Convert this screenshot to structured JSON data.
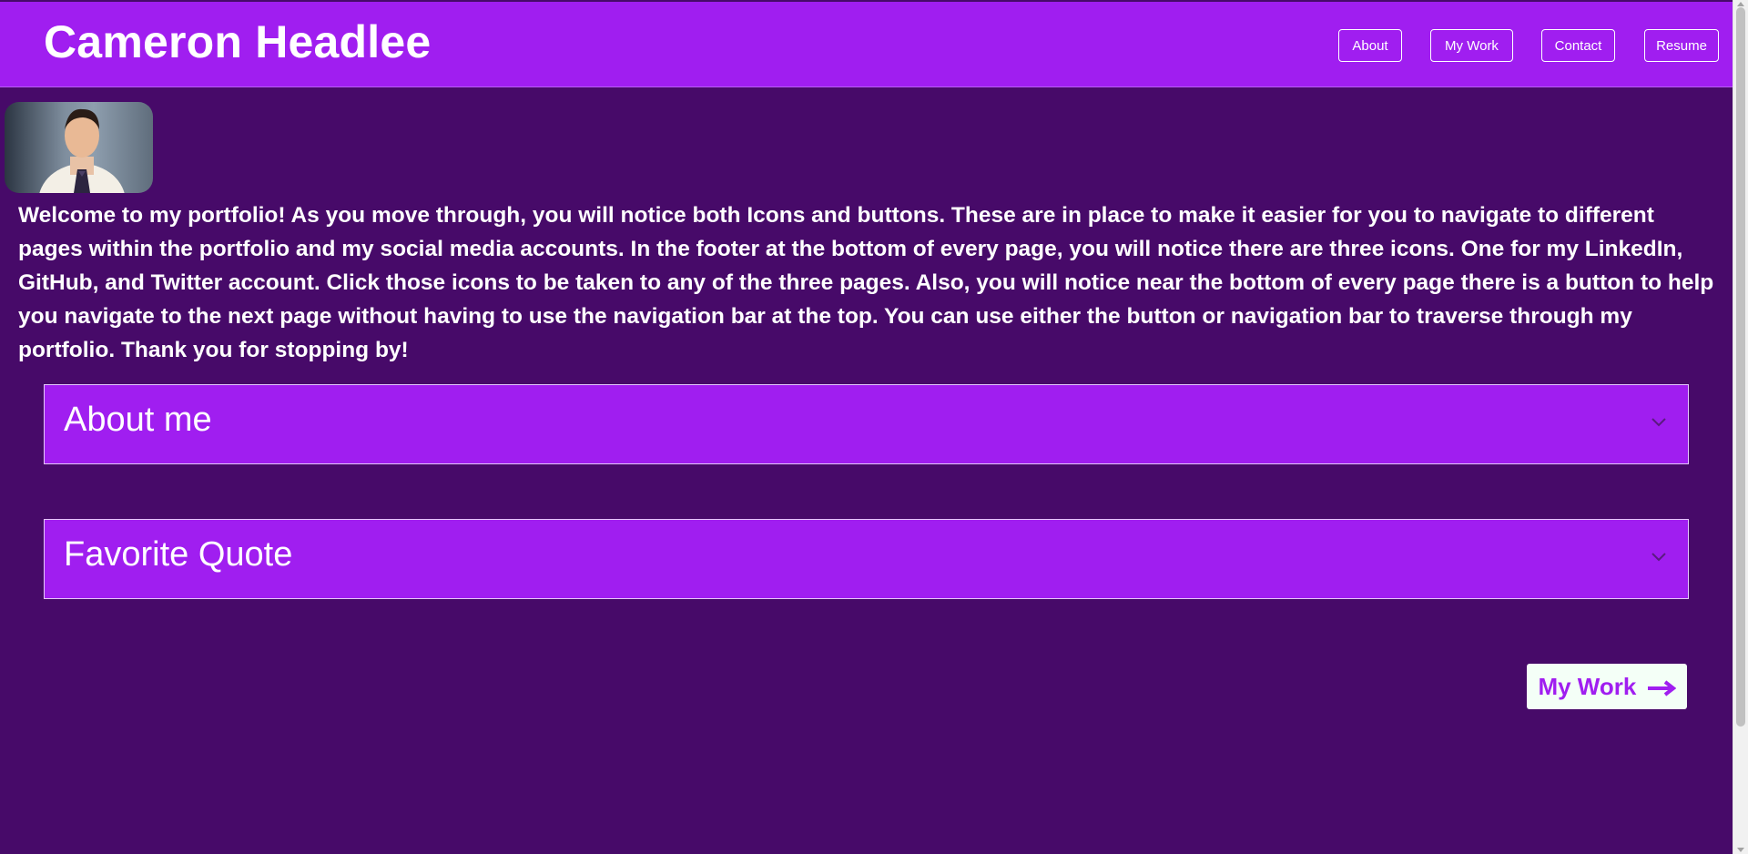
{
  "header": {
    "title": "Cameron Headlee",
    "nav": [
      {
        "label": "About"
      },
      {
        "label": "My Work"
      },
      {
        "label": "Contact"
      },
      {
        "label": "Resume"
      }
    ]
  },
  "main": {
    "intro": "Welcome to my portfolio! As you move through, you will notice both Icons and buttons. These are in place to make it easier for you to navigate to different pages within the portfolio and my social media accounts. In the footer at the bottom of every page, you will notice there are three icons. One for my LinkedIn, GitHub, and Twitter account. Click those icons to be taken to any of the three pages. Also, you will notice near the bottom of every page there is a button to help you navigate to the next page without having to use the navigation bar at the top. You can use either the button or navigation bar to traverse through my portfolio. Thank you for stopping by!",
    "accordions": [
      {
        "title": "About me"
      },
      {
        "title": "Favorite Quote"
      }
    ],
    "next_button": {
      "label": "My Work",
      "icon": "arrow-right-icon"
    }
  },
  "colors": {
    "header_bg": "#a01ef0",
    "page_bg": "#470a69",
    "accent": "#a01ef0",
    "button_bg": "#f4fff7"
  }
}
